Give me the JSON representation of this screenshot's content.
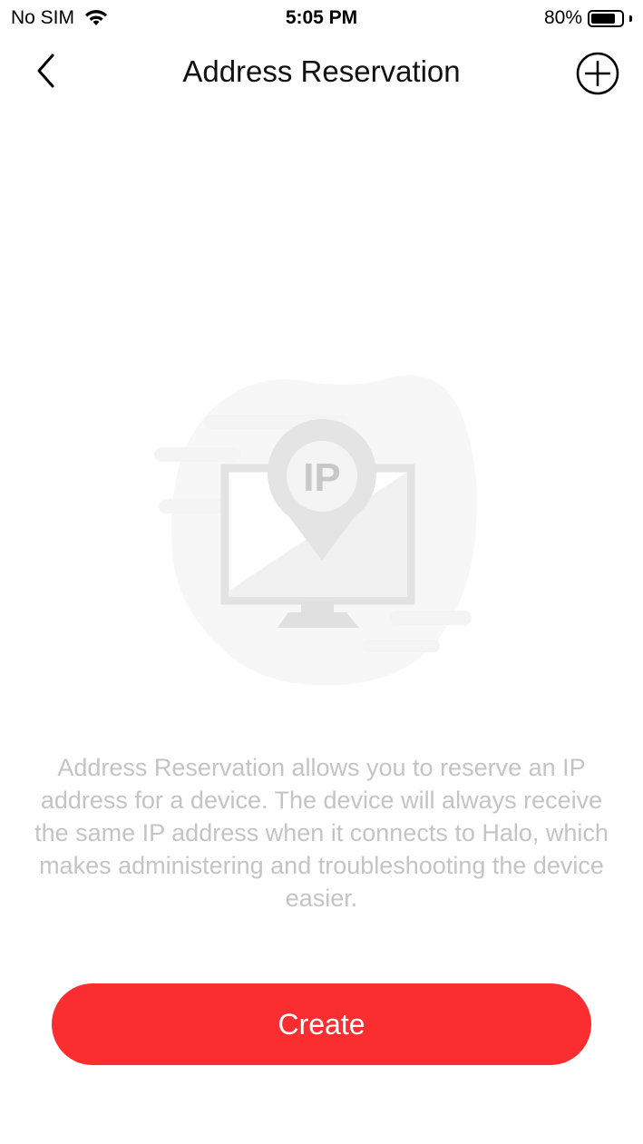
{
  "status_bar": {
    "carrier": "No SIM",
    "time": "5:05 PM",
    "battery_text": "80%",
    "battery_level": 0.8
  },
  "nav": {
    "title": "Address Reservation",
    "back_icon": "chevron-left-icon",
    "add_icon": "plus-circle-icon"
  },
  "illustration": {
    "label": "IP",
    "icon": "monitor-ip-pin-icon"
  },
  "description": "Address Reservation allows you to reserve an IP address for a device. The device will always receive the same IP address when it connects to Halo, which makes administering and troubleshooting the device easier.",
  "create_button": {
    "label": "Create",
    "color": "#fa2e31"
  }
}
